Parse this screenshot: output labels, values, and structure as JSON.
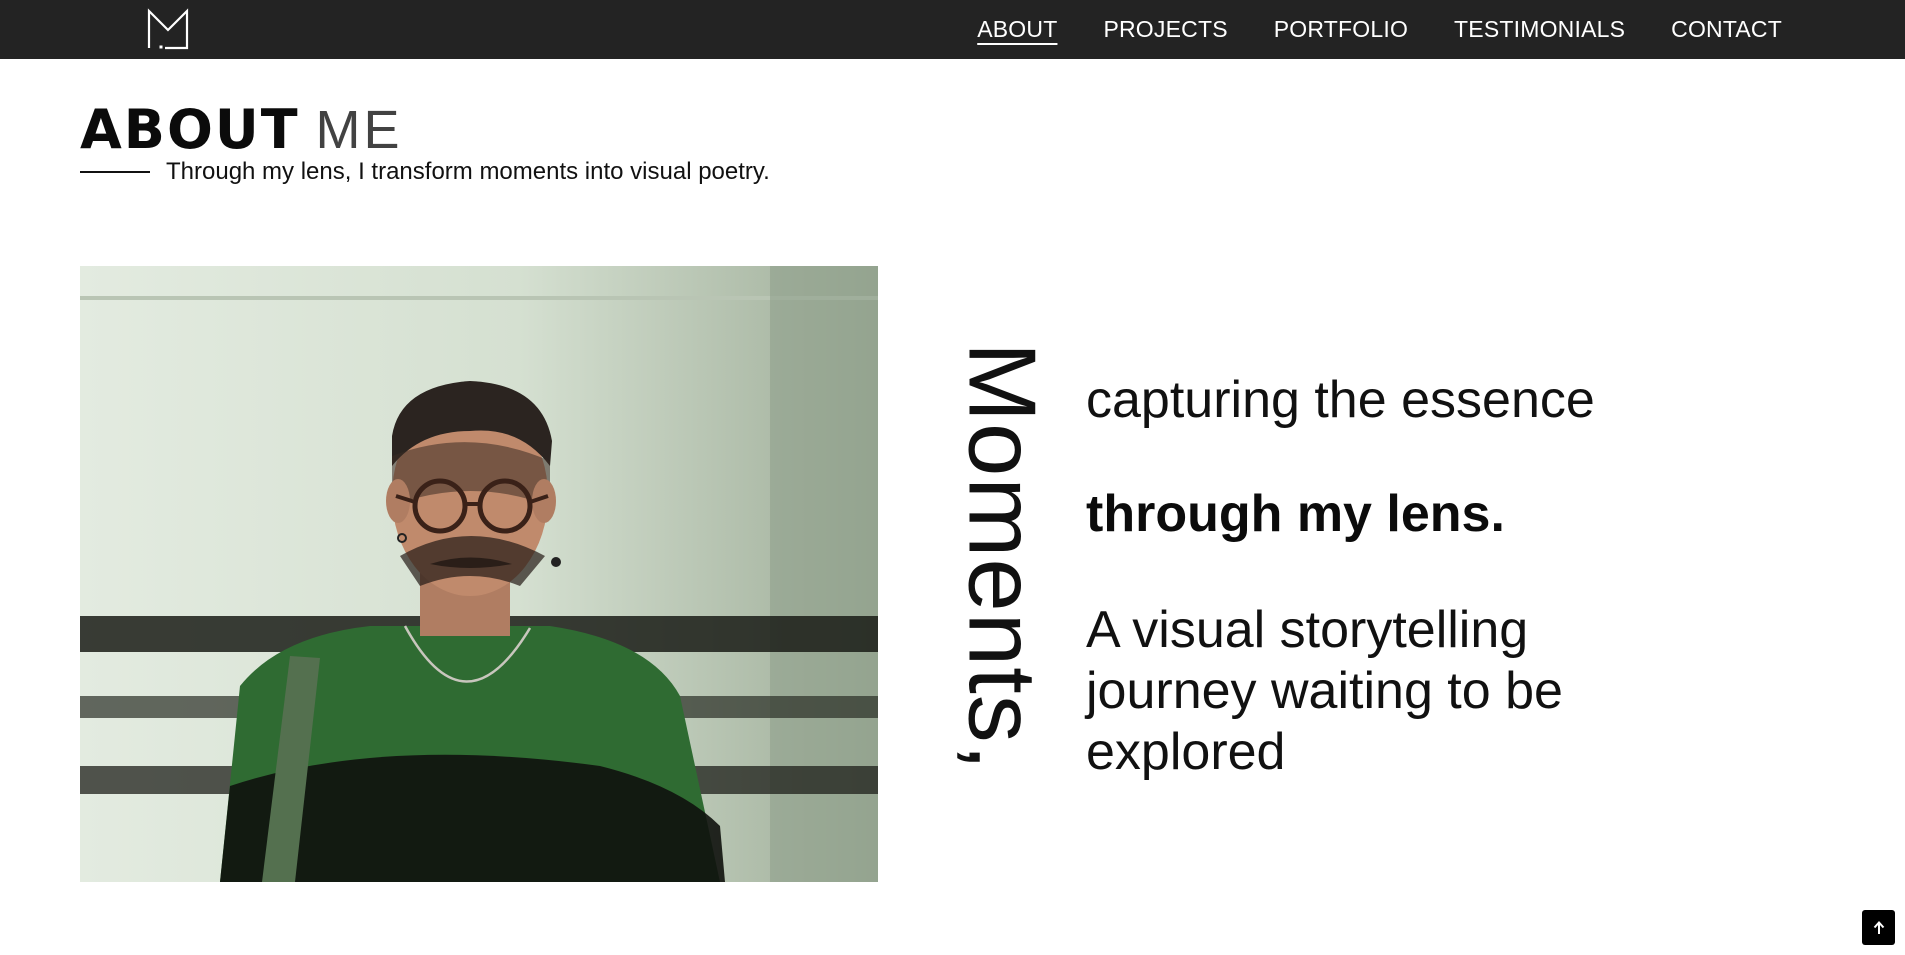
{
  "nav": {
    "logo_icon": "monogram-m-logo",
    "links": [
      {
        "label": "ABOUT",
        "active": true
      },
      {
        "label": "PROJECTS",
        "active": false
      },
      {
        "label": "PORTFOLIO",
        "active": false
      },
      {
        "label": "TESTIMONIALS",
        "active": false
      },
      {
        "label": "CONTACT",
        "active": false
      }
    ]
  },
  "hero": {
    "heading_bold": "ABOUT",
    "heading_light": "ME",
    "tagline": "Through my lens, I transform moments into visual poetry."
  },
  "feature": {
    "photo_icon": "portrait-photo",
    "vertical_word": "Moments,",
    "line_1": "capturing the essence",
    "line_2": "through my lens.",
    "line_3": "A visual storytelling journey waiting to be explored"
  },
  "scroll_top": {
    "icon": "arrow-up-icon"
  },
  "colors": {
    "nav_background": "#232323",
    "page_background": "#ffffff",
    "text": "#111111"
  }
}
